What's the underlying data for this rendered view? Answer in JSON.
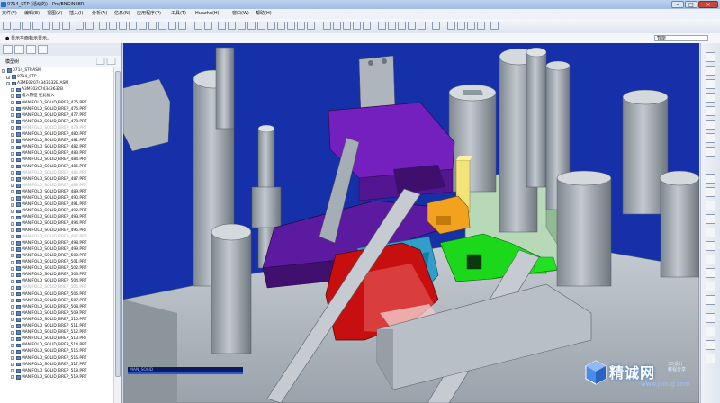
{
  "window": {
    "title": "0714_STP (活动的) - Pro/ENGINEER"
  },
  "menu": [
    {
      "label": "文件(F)"
    },
    {
      "label": "编辑(E)"
    },
    {
      "label": "视图(V)"
    },
    {
      "label": "插入(I)"
    },
    {
      "label": "分析(A)"
    },
    {
      "label": "信息(N)"
    },
    {
      "label": "应用程序(P)"
    },
    {
      "label": "工具(T)"
    },
    {
      "label": "Huazhu(H)"
    },
    {
      "label": "窗口(W)"
    },
    {
      "label": "帮助(H)"
    }
  ],
  "message_bar": {
    "message": "● 显示平面标示显示。",
    "search_value": "智能"
  },
  "side_panel": {
    "tree_label": "模型树"
  },
  "tree": [
    {
      "label": "0714_STP.ASM",
      "level": 0,
      "dim": false
    },
    {
      "label": "0714_STP",
      "level": 1,
      "dim": false
    },
    {
      "label": "A3ME02074343632B.ASM",
      "level": 1,
      "dim": false
    },
    {
      "label": "A3ME02074343632B",
      "level": 2,
      "dim": false
    },
    {
      "label": "插入特征 在此插入",
      "level": 2,
      "dim": false
    },
    {
      "label": "MANIFOLD_SOLID_BREP_475.PRT",
      "level": 2,
      "dim": false
    },
    {
      "label": "MANIFOLD_SOLID_BREP_476.PRT",
      "level": 2,
      "dim": false
    },
    {
      "label": "MANIFOLD_SOLID_BREP_477.PRT",
      "level": 2,
      "dim": false
    },
    {
      "label": "MANIFOLD_SOLID_BREP_478.PRT",
      "level": 2,
      "dim": false
    },
    {
      "label": "MANIFOLD_SOLID_BREP_479.PRT",
      "level": 2,
      "dim": true
    },
    {
      "label": "MANIFOLD_SOLID_BREP_480.PRT",
      "level": 2,
      "dim": false
    },
    {
      "label": "MANIFOLD_SOLID_BREP_481.PRT",
      "level": 2,
      "dim": false
    },
    {
      "label": "MANIFOLD_SOLID_BREP_482.PRT",
      "level": 2,
      "dim": false
    },
    {
      "label": "MANIFOLD_SOLID_BREP_483.PRT",
      "level": 2,
      "dim": false
    },
    {
      "label": "MANIFOLD_SOLID_BREP_484.PRT",
      "level": 2,
      "dim": false
    },
    {
      "label": "MANIFOLD_SOLID_BREP_485.PRT",
      "level": 2,
      "dim": false
    },
    {
      "label": "MANIFOLD_SOLID_BREP_486.PRT",
      "level": 2,
      "dim": true
    },
    {
      "label": "MANIFOLD_SOLID_BREP_487.PRT",
      "level": 2,
      "dim": false
    },
    {
      "label": "MANIFOLD_SOLID_BREP_488.PRT",
      "level": 2,
      "dim": true
    },
    {
      "label": "MANIFOLD_SOLID_BREP_489.PRT",
      "level": 2,
      "dim": false
    },
    {
      "label": "MANIFOLD_SOLID_BREP_490.PRT",
      "level": 2,
      "dim": false
    },
    {
      "label": "MANIFOLD_SOLID_BREP_491.PRT",
      "level": 2,
      "dim": false
    },
    {
      "label": "MANIFOLD_SOLID_BREP_492.PRT",
      "level": 2,
      "dim": false
    },
    {
      "label": "MANIFOLD_SOLID_BREP_493.PRT",
      "level": 2,
      "dim": false
    },
    {
      "label": "MANIFOLD_SOLID_BREP_494.PRT",
      "level": 2,
      "dim": false
    },
    {
      "label": "MANIFOLD_SOLID_BREP_495.PRT",
      "level": 2,
      "dim": false
    },
    {
      "label": "MANIFOLD_SOLID_BREP_497.PRT",
      "level": 2,
      "dim": true
    },
    {
      "label": "MANIFOLD_SOLID_BREP_498.PRT",
      "level": 2,
      "dim": false
    },
    {
      "label": "MANIFOLD_SOLID_BREP_499.PRT",
      "level": 2,
      "dim": false
    },
    {
      "label": "MANIFOLD_SOLID_BREP_500.PRT",
      "level": 2,
      "dim": false
    },
    {
      "label": "MANIFOLD_SOLID_BREP_501.PRT",
      "level": 2,
      "dim": false
    },
    {
      "label": "MANIFOLD_SOLID_BREP_502.PRT",
      "level": 2,
      "dim": false
    },
    {
      "label": "MANIFOLD_SOLID_BREP_503.PRT",
      "level": 2,
      "dim": false
    },
    {
      "label": "MANIFOLD_SOLID_BREP_504.PRT",
      "level": 2,
      "dim": false
    },
    {
      "label": "MANIFOLD_SOLID_BREP_505.PRT",
      "level": 2,
      "dim": true
    },
    {
      "label": "MANIFOLD_SOLID_BREP_506.PRT",
      "level": 2,
      "dim": false
    },
    {
      "label": "MANIFOLD_SOLID_BREP_507.PRT",
      "level": 2,
      "dim": false
    },
    {
      "label": "MANIFOLD_SOLID_BREP_508.PRT",
      "level": 2,
      "dim": false
    },
    {
      "label": "MANIFOLD_SOLID_BREP_509.PRT",
      "level": 2,
      "dim": false
    },
    {
      "label": "MANIFOLD_SOLID_BREP_510.PRT",
      "level": 2,
      "dim": false
    },
    {
      "label": "MANIFOLD_SOLID_BREP_511.PRT",
      "level": 2,
      "dim": false
    },
    {
      "label": "MANIFOLD_SOLID_BREP_512.PRT",
      "level": 2,
      "dim": false
    },
    {
      "label": "MANIFOLD_SOLID_BREP_513.PRT",
      "level": 2,
      "dim": false
    },
    {
      "label": "MANIFOLD_SOLID_BREP_514.PRT",
      "level": 2,
      "dim": false
    },
    {
      "label": "MANIFOLD_SOLID_BREP_515.PRT",
      "level": 2,
      "dim": false
    },
    {
      "label": "MANIFOLD_SOLID_BREP_516.PRT",
      "level": 2,
      "dim": false
    },
    {
      "label": "MANIFOLD_SOLID_BREP_517.PRT",
      "level": 2,
      "dim": false
    },
    {
      "label": "MANIFOLD_SOLID_BREP_518.PRT",
      "level": 2,
      "dim": false
    },
    {
      "label": "MANIFOLD_SOLID_BREP_519.PRT",
      "level": 2,
      "dim": false
    }
  ],
  "viewport": {
    "status_text": "MAN_SOLID"
  },
  "watermark": {
    "brand": "精诚网",
    "sub1": "3D设计",
    "sub2": "教程分享",
    "url": "www.jcoug.com"
  },
  "colors": {
    "viewport_bg": "#1530a8",
    "mold_gray": "#b8bfc6",
    "slider_purple": "#6b1fb0",
    "insert_red": "#c80f10",
    "part_green": "#1bd81b",
    "block_orange": "#f2a21e",
    "pin_yellow": "#f3e47a",
    "cyan_insert": "#2f9ec9",
    "plate_mint": "#b7d9b8"
  }
}
